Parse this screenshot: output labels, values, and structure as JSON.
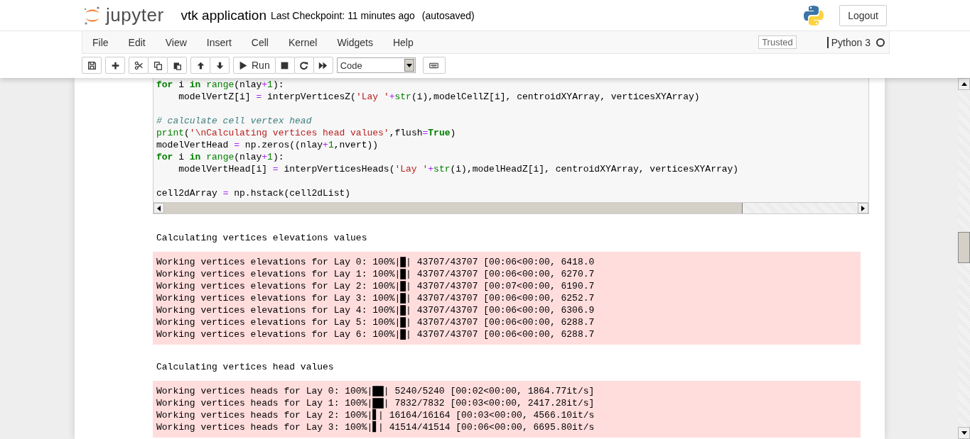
{
  "header": {
    "logo_text": "jupyter",
    "notebook_name": "vtk application",
    "checkpoint": "Last Checkpoint: 11 minutes ago",
    "autosave": "(autosaved)",
    "logout": "Logout"
  },
  "menu": [
    "File",
    "Edit",
    "View",
    "Insert",
    "Cell",
    "Kernel",
    "Widgets",
    "Help"
  ],
  "trusted": "Trusted",
  "kernel_name": "Python 3",
  "toolbar": {
    "run_label": "Run",
    "cell_type": "Code"
  },
  "code_cell": {
    "paragraphs": [
      [
        [
          {
            "kind": "kw",
            "t": "for"
          },
          {
            "kind": "plain",
            "t": " i "
          },
          {
            "kind": "kw",
            "t": "in"
          },
          {
            "kind": "builtin",
            "t": " range"
          },
          {
            "kind": "plain",
            "t": "(nlay"
          },
          {
            "kind": "op",
            "t": "+"
          },
          {
            "kind": "num",
            "t": "1"
          },
          {
            "kind": "plain",
            "t": "):"
          }
        ],
        [
          {
            "kind": "plain",
            "t": "    modelVertZ[i] "
          },
          {
            "kind": "op",
            "t": "="
          },
          {
            "kind": "plain",
            "t": " interpVerticesZ("
          },
          {
            "kind": "str",
            "t": "'Lay '"
          },
          {
            "kind": "op",
            "t": "+"
          },
          {
            "kind": "builtin",
            "t": "str"
          },
          {
            "kind": "plain",
            "t": "(i),modelCellZ[i], centroidXYArray, verticesXYArray)"
          }
        ]
      ],
      [
        [
          {
            "kind": "comment",
            "t": "# calculate cell vertex head"
          }
        ],
        [
          {
            "kind": "builtin",
            "t": "print"
          },
          {
            "kind": "plain",
            "t": "("
          },
          {
            "kind": "str",
            "t": "'\\nCalculating vertices head values'"
          },
          {
            "kind": "plain",
            "t": ",flush"
          },
          {
            "kind": "op",
            "t": "="
          },
          {
            "kind": "kw",
            "t": "True"
          },
          {
            "kind": "plain",
            "t": ")"
          }
        ],
        [
          {
            "kind": "plain",
            "t": "modelVertHead "
          },
          {
            "kind": "op",
            "t": "="
          },
          {
            "kind": "plain",
            "t": " np.zeros((nlay"
          },
          {
            "kind": "op",
            "t": "+"
          },
          {
            "kind": "num",
            "t": "1"
          },
          {
            "kind": "plain",
            "t": ",nvert))"
          }
        ],
        [
          {
            "kind": "kw",
            "t": "for"
          },
          {
            "kind": "plain",
            "t": " i "
          },
          {
            "kind": "kw",
            "t": "in"
          },
          {
            "kind": "builtin",
            "t": " range"
          },
          {
            "kind": "plain",
            "t": "(nlay"
          },
          {
            "kind": "op",
            "t": "+"
          },
          {
            "kind": "num",
            "t": "1"
          },
          {
            "kind": "plain",
            "t": "):"
          }
        ],
        [
          {
            "kind": "plain",
            "t": "    modelVertHead[i] "
          },
          {
            "kind": "op",
            "t": "="
          },
          {
            "kind": "plain",
            "t": " interpVerticesHeads("
          },
          {
            "kind": "str",
            "t": "'Lay '"
          },
          {
            "kind": "op",
            "t": "+"
          },
          {
            "kind": "builtin",
            "t": "str"
          },
          {
            "kind": "plain",
            "t": "(i),modelHeadZ[i], centroidXYArray, verticesXYArray)"
          }
        ]
      ],
      [
        [
          {
            "kind": "plain",
            "t": "cell2dArray "
          },
          {
            "kind": "op",
            "t": "="
          },
          {
            "kind": "plain",
            "t": " np.hstack(cell2dList)"
          }
        ]
      ]
    ]
  },
  "outputs": [
    {
      "kind": "stdout",
      "text": "Calculating vertices elevations values"
    },
    {
      "kind": "stderr",
      "rows": [
        {
          "text": "Working vertices elevations for Lay 0: 100%|█| 43707/43707 [00:06<00:00, 6418.0"
        },
        {
          "text": "Working vertices elevations for Lay 1: 100%|█| 43707/43707 [00:06<00:00, 6270.7"
        },
        {
          "text": "Working vertices elevations for Lay 2: 100%|█| 43707/43707 [00:07<00:00, 6190.7"
        },
        {
          "text": "Working vertices elevations for Lay 3: 100%|█| 43707/43707 [00:06<00:00, 6252.7"
        },
        {
          "text": "Working vertices elevations for Lay 4: 100%|█| 43707/43707 [00:06<00:00, 6306.9"
        },
        {
          "text": "Working vertices elevations for Lay 5: 100%|█| 43707/43707 [00:06<00:00, 6288.7"
        },
        {
          "text": "Working vertices elevations for Lay 6: 100%|█| 43707/43707 [00:06<00:00, 6288.7"
        }
      ]
    },
    {
      "kind": "stdout",
      "text": "Calculating vertices head values"
    },
    {
      "kind": "stderr",
      "rows": [
        {
          "text": "Working vertices heads for Lay 0: 100%|██| 5240/5240 [00:02<00:00, 1864.77it/s]"
        },
        {
          "text": "Working vertices heads for Lay 1: 100%|██| 7832/7832 [00:03<00:00, 2417.28it/s]"
        },
        {
          "text": "Working vertices heads for Lay 2: 100%|▋| 16164/16164 [00:03<00:00, 4566.10it/s"
        },
        {
          "text": "Working vertices heads for Lay 3: 100%|▋| 41514/41514 [00:06<00:00, 6695.80it/s"
        }
      ]
    }
  ]
}
